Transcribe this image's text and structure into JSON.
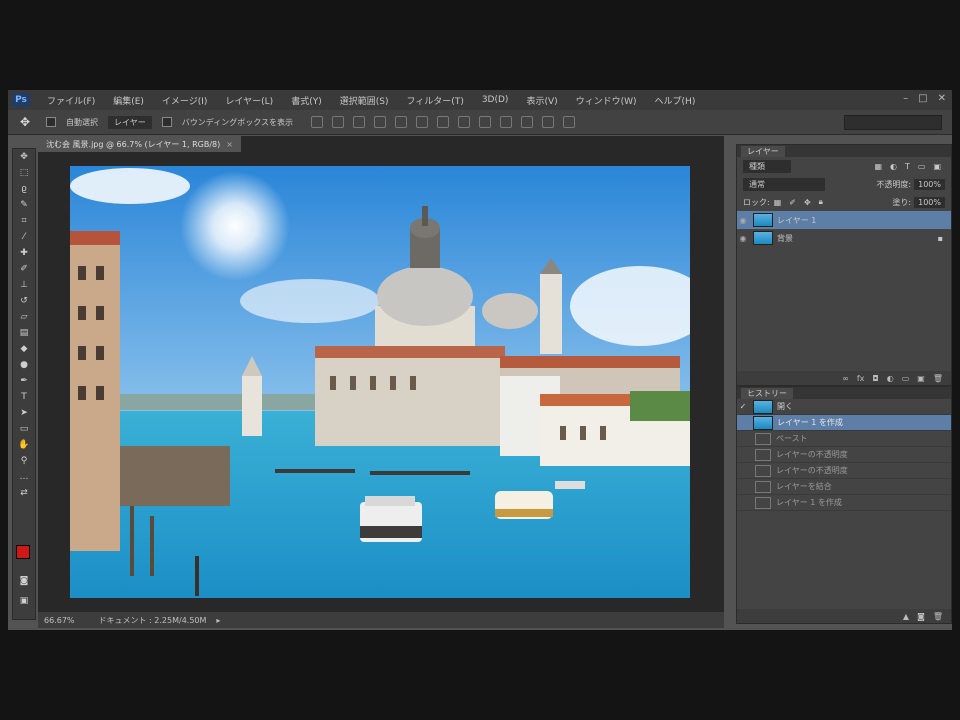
{
  "menu": {
    "logo": "Ps",
    "items": [
      "ファイル(F)",
      "編集(E)",
      "イメージ(I)",
      "レイヤー(L)",
      "書式(Y)",
      "選択範囲(S)",
      "フィルター(T)",
      "3D(D)",
      "表示(V)",
      "ウィンドウ(W)",
      "ヘルプ(H)"
    ],
    "window_controls": [
      "–",
      "□",
      "✕"
    ]
  },
  "options": {
    "tool_icon": "move-tool-icon",
    "auto_select_label": "自動選択",
    "auto_select_value": "レイヤー",
    "transform_label": "バウンディングボックスを表示"
  },
  "document": {
    "tab_label": "沈む会 風景.jpg @ 66.7% (レイヤー 1, RGB/8)",
    "zoom": "66.67%",
    "status_text": "ドキュメント : 2.25M/4.50M"
  },
  "layers_panel": {
    "tab": "レイヤー",
    "kind_label": "種類",
    "blend_mode": "通常",
    "opacity_label": "不透明度:",
    "opacity_value": "100%",
    "fill_label": "塗り:",
    "fill_value": "100%",
    "layers": [
      {
        "name": "レイヤー 1",
        "selected": true
      },
      {
        "name": "背景",
        "selected": false
      }
    ]
  },
  "history_panel": {
    "tab": "ヒストリー",
    "items": [
      {
        "name": "開く",
        "state": "normal"
      },
      {
        "name": "レイヤー 1 を作成",
        "state": "selected"
      },
      {
        "name": "ペースト",
        "state": "faded"
      },
      {
        "name": "レイヤーの不透明度",
        "state": "faded"
      },
      {
        "name": "レイヤーの不透明度",
        "state": "faded"
      },
      {
        "name": "レイヤーを結合",
        "state": "faded"
      },
      {
        "name": "レイヤー 1 を作成",
        "state": "faded"
      }
    ]
  },
  "colors": {
    "app_bg": "#535353",
    "foreground_swatch": "#d01818",
    "background_swatch": "#ffffff",
    "selection": "#5d7ea6"
  }
}
